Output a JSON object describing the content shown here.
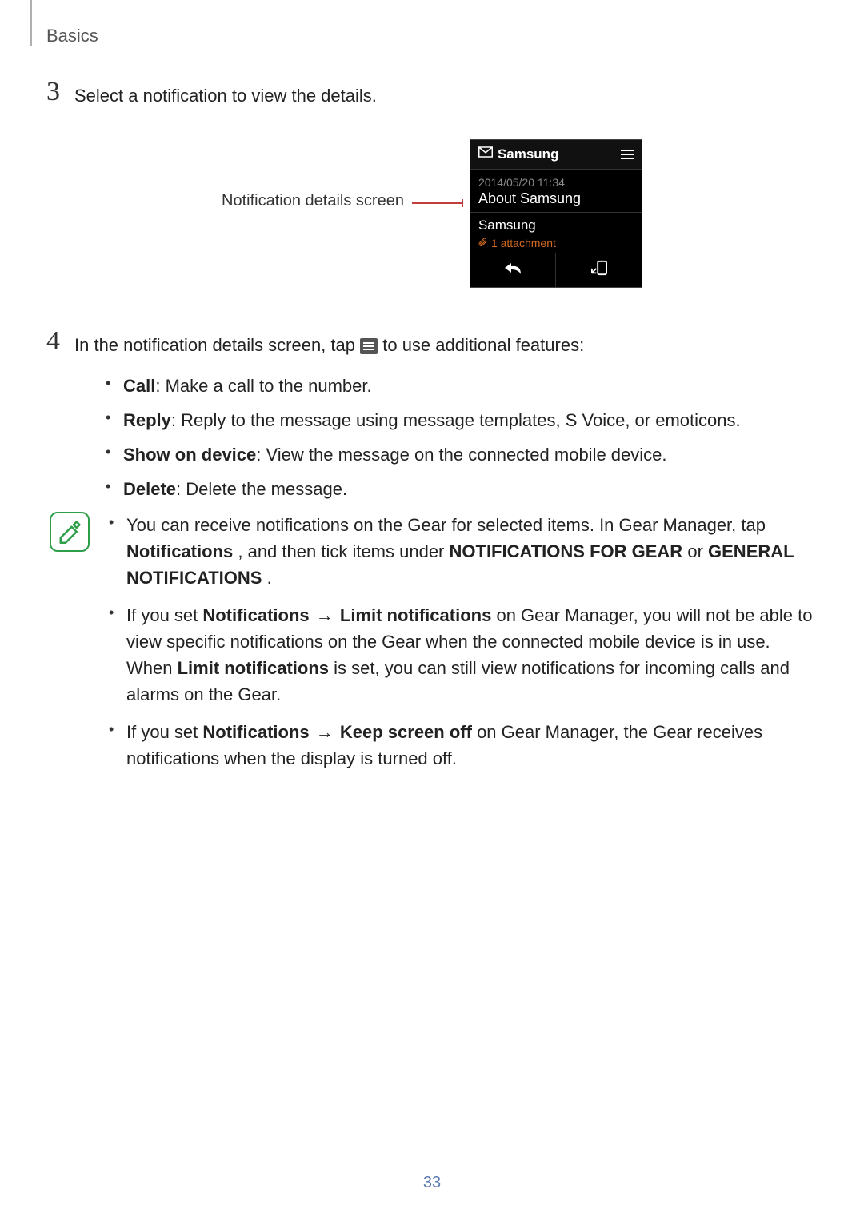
{
  "header": {
    "section": "Basics"
  },
  "step3": {
    "num": "3",
    "text": "Select a notification to view the details."
  },
  "figure": {
    "callout": "Notification details screen",
    "screen": {
      "title": "Samsung",
      "time": "2014/05/20 11:34",
      "subject": "About Samsung",
      "message": "Samsung",
      "attachment": "1 attachment",
      "action_reply": "↩",
      "action_device": "⇱"
    }
  },
  "step4": {
    "num": "4",
    "intro_prefix": "In the notification details screen, tap ",
    "intro_suffix": " to use additional features:",
    "items": {
      "call": {
        "label": "Call",
        "text": ": Make a call to the number."
      },
      "reply": {
        "label": "Reply",
        "text": ": Reply to the message using message templates, S Voice, or emoticons."
      },
      "show": {
        "label": "Show on device",
        "text": ": View the message on the connected mobile device."
      },
      "delete": {
        "label": "Delete",
        "text": ": Delete the message."
      }
    }
  },
  "note": {
    "n1_a": "You can receive notifications on the Gear for selected items. In Gear Manager, tap ",
    "n1_b1": "Notifications",
    "n1_c": ", and then tick items under ",
    "n1_b2": "NOTIFICATIONS FOR GEAR",
    "n1_d": " or ",
    "n1_b3": "GENERAL NOTIFICATIONS",
    "n1_e": ".",
    "n2_a": "If you set ",
    "n2_b1": "Notifications",
    "n2_arrow": " → ",
    "n2_b2": "Limit notifications",
    "n2_c": " on Gear Manager, you will not be able to view specific notifications on the Gear when the connected mobile device is in use. When ",
    "n2_b3": "Limit notifications",
    "n2_d": " is set, you can still view notifications for incoming calls and alarms on the Gear.",
    "n3_a": "If you set ",
    "n3_b1": "Notifications",
    "n3_arrow": " → ",
    "n3_b2": "Keep screen off",
    "n3_c": " on Gear Manager, the Gear receives notifications when the display is turned off."
  },
  "page_number": "33"
}
